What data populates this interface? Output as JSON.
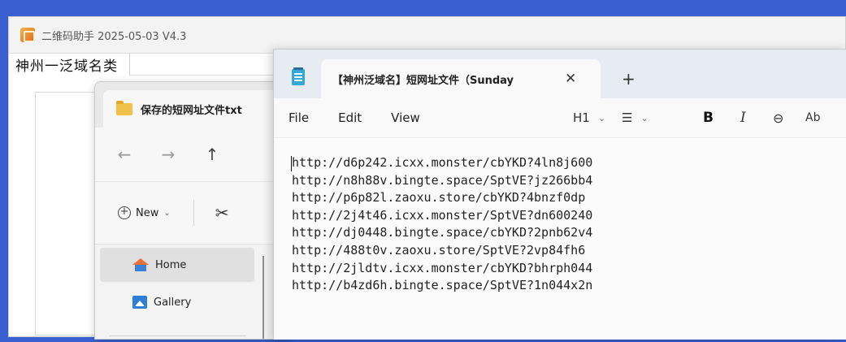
{
  "app": {
    "title": "二维码助手 2025-05-03 V4.3",
    "tab_label": "神州一泛域名类"
  },
  "explorer": {
    "tab_label": "保存的短网址文件txt",
    "nav": {
      "back": "←",
      "forward": "→",
      "up": "↑"
    },
    "new_label": "New",
    "cut_glyph": "✂",
    "sidebar": [
      {
        "label": "Home"
      },
      {
        "label": "Gallery"
      }
    ]
  },
  "notepad": {
    "tab_label": "【神州泛域名】短网址文件（Sunday",
    "close_glyph": "✕",
    "new_tab_glyph": "+",
    "menu": {
      "file": "File",
      "edit": "Edit",
      "view": "View"
    },
    "format": {
      "heading": "H1",
      "list": "☰",
      "bold": "B",
      "italic": "I",
      "link": "⊖",
      "spell": "Ab"
    },
    "lines": [
      "http://d6p242.icxx.monster/cbYKD?4ln8j600",
      "http://n8h88v.bingte.space/SptVE?jz266bb4",
      "http://p6p82l.zaoxu.store/cbYKD?4bnzf0dp",
      "http://2j4t46.icxx.monster/SptVE?dn600240",
      "http://dj0448.bingte.space/cbYKD?2pnb62v4",
      "http://488t0v.zaoxu.store/SptVE?2vp84fh6",
      "http://2jldtv.icxx.monster/cbYKD?bhrph044",
      "http://b4zd6h.bingte.space/SptVE?1n044x2n"
    ]
  },
  "colors": {
    "desktop": "#3a5fd0",
    "notepad_tabbar": "#e7ecf2",
    "folder": "#f2c14a"
  }
}
